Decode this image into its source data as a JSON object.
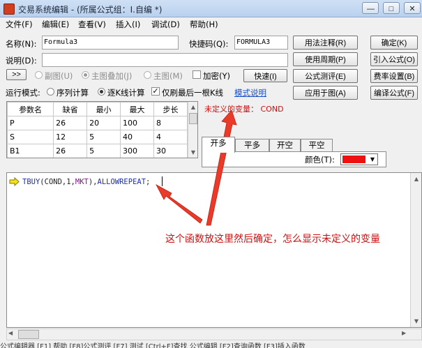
{
  "window": {
    "title": "交易系统编辑 - (所属公式组：I.自编 *)",
    "btn_minimize": "—",
    "btn_maximize": "□",
    "btn_close": "✕"
  },
  "menu": [
    "文件(F)",
    "编辑(E)",
    "查看(V)",
    "插入(I)",
    "调试(D)",
    "帮助(H)"
  ],
  "form": {
    "name_label": "名称(N):",
    "name_value": "Formula3",
    "hotkey_label": "快捷码(Q):",
    "hotkey_value": "FORMULA3",
    "desc_label": "说明(D):",
    "desc_value": "",
    "expand_btn": ">>",
    "sub_chart": "副图(U)",
    "main_overlay": "主图叠加(J)",
    "main_chart": "主图(M)",
    "encrypt": "加密(Y)",
    "fast_btn": "快速(I)",
    "run_mode_label": "运行模式:",
    "seq_calc": "序列计算",
    "tick_calc": "逐K线计算",
    "last_bar_only": "仅刷最后一根K线",
    "mode_help_link": "模式说明"
  },
  "right_buttons": {
    "usage_note": "用法注释(R)",
    "confirm": "确定(K)",
    "use_period": "使用周期(P)",
    "import": "引入公式(O)",
    "test": "公式测评(E)",
    "fee": "费率设置(B)",
    "apply": "应用于图(A)",
    "compile": "编译公式(F)"
  },
  "params_table": {
    "headers": [
      "参数名",
      "缺省",
      "最小",
      "最大",
      "步长"
    ],
    "rows": [
      [
        "P",
        "26",
        "20",
        "100",
        "8"
      ],
      [
        "S",
        "12",
        "5",
        "40",
        "4"
      ],
      [
        "B1",
        "26",
        "5",
        "300",
        "30"
      ]
    ]
  },
  "error_text": "未定义的变量： COND",
  "signal_tabs": {
    "tabs": [
      "开多",
      "平多",
      "开空",
      "平空"
    ],
    "active": "开多",
    "color_label": "颜色(T):",
    "color_value": "#ee1111"
  },
  "code": {
    "fn": "TBUY",
    "open": "(COND,1,",
    "mkt": "MKT",
    "mid": "),",
    "allow": "ALLOWREPEAT",
    "end": ";"
  },
  "annotation": "这个函数放这里然后确定，怎么显示未定义的变量",
  "status_text": "公式编辑器 [F1] 帮助   [F8]公式测评   [F7] 测试   [Ctrl+F]查找   公式编辑   [F2]查询函数   [F3]插入函数",
  "colors": {
    "error_red": "#d01010",
    "annotation_red": "#d01010",
    "arrow_red": "#ea3a2a",
    "link_blue": "#1a4fc7"
  }
}
